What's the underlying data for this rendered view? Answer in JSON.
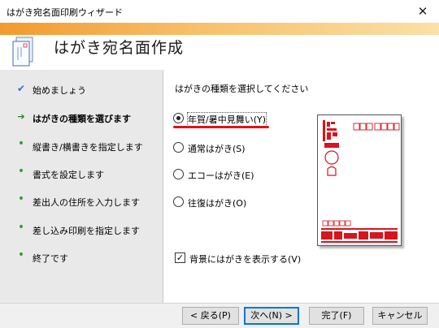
{
  "window": {
    "title": "はがき宛名面印刷ウィザード",
    "close": "✕"
  },
  "header": {
    "heading": "はがき宛名面作成"
  },
  "steps": [
    {
      "mark": "✔",
      "label": "始めましょう",
      "state": "done"
    },
    {
      "mark": "➔",
      "label": "はがきの種類を選びます",
      "state": "current"
    },
    {
      "mark": "•",
      "label": "縦書き/横書きを指定します",
      "state": "todo"
    },
    {
      "mark": "•",
      "label": "書式を設定します",
      "state": "todo"
    },
    {
      "mark": "•",
      "label": "差出人の住所を入力します",
      "state": "todo"
    },
    {
      "mark": "•",
      "label": "差し込み印刷を指定します",
      "state": "todo"
    },
    {
      "mark": "•",
      "label": "終了です",
      "state": "todo"
    }
  ],
  "content": {
    "prompt": "はがきの種類を選択してください",
    "options": [
      {
        "label": "年賀/暑中見舞い(Y)",
        "selected": true
      },
      {
        "label": "通常はがき(S)",
        "selected": false
      },
      {
        "label": "エコーはがき(E)",
        "selected": false
      },
      {
        "label": "往復はがき(O)",
        "selected": false
      }
    ],
    "background_check": {
      "label": "背景にはがきを表示する(V)",
      "checked": true,
      "mark": "✓"
    }
  },
  "buttons": {
    "back": "< 戻る(P)",
    "next": "次へ(N) >",
    "finish": "完了(F)",
    "cancel": "キャンセル"
  },
  "colors": {
    "accent_red": "#e0121b",
    "stripe": "#f29a2e",
    "card_red": "#d8141c"
  }
}
